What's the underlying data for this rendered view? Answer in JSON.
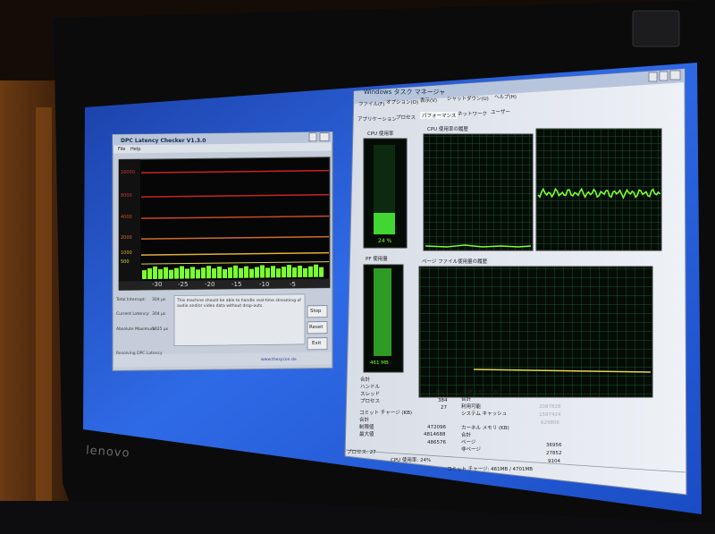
{
  "laptop": {
    "brand": "lenovo"
  },
  "dpc_window": {
    "title": "DPC Latency Checker V1.3.0",
    "menu": [
      "File",
      "Help"
    ],
    "x_ticks": [
      "-30",
      "-25",
      "-20",
      "-15",
      "-10",
      "-5"
    ],
    "y_ticks": [
      "16000",
      "8000",
      "4000",
      "2000",
      "1000",
      "500"
    ],
    "stats_labels": [
      "Total Interrupt:",
      "Current Latency:",
      "Absolute Maximum:"
    ],
    "stats_values": [
      "304 µs",
      "304 µs",
      "1025 µs"
    ],
    "message": "This machine should be able to handle real-time streaming of audio and/or video data without drop-outs.",
    "buttons": [
      "Stop",
      "Reset",
      "Exit"
    ],
    "footer_left": "Resolving DPC Latency",
    "footer_right": "www.thesycon.de"
  },
  "task_manager": {
    "title": "Windows タスク マネージャ",
    "menu": [
      "ファイル(F)",
      "オプション(O)",
      "表示(V)",
      "シャットダウン(U)",
      "ヘルプ(H)"
    ],
    "tabs": [
      "アプリケーション",
      "プロセス",
      "パフォーマンス",
      "ネットワーク",
      "ユーザー"
    ],
    "active_tab": 2,
    "cpu_usage_label": "CPU 使用率",
    "cpu_usage_value": "24 %",
    "cpu_usage_level": 0.24,
    "cpu_history_label": "CPU 使用率の履歴",
    "pf_usage_label": "PF 使用量",
    "pf_usage_value": "461 MB",
    "pf_history_label": "ページ ファイル使用量の履歴",
    "totals": {
      "header": "合計",
      "rows": [
        [
          "ハンドル",
          "7027"
        ],
        [
          "スレッド",
          "384"
        ],
        [
          "プロセス",
          "27"
        ]
      ]
    },
    "physical_memory": {
      "header": "物理メモリ (KB)",
      "rows": [
        [
          "合計",
          "2087828"
        ],
        [
          "利用可能",
          "1597424"
        ],
        [
          "システム キャッシュ",
          "629806"
        ]
      ]
    },
    "commit_charge": {
      "header": "コミット チャージ (KB)",
      "rows": [
        [
          "合計",
          "472096"
        ],
        [
          "制限値",
          "4814688"
        ],
        [
          "最大値",
          "486576"
        ]
      ]
    },
    "kernel_memory": {
      "header": "カーネル メモリ (KB)",
      "rows": [
        [
          "合計",
          "36956"
        ],
        [
          "ページ",
          "27852"
        ],
        [
          "非ページ",
          "9104"
        ]
      ]
    },
    "status_bar": [
      "プロセス: 27",
      "CPU 使用率: 24%",
      "コミット チャージ: 461MB / 4701MB"
    ]
  },
  "colors": {
    "graph_green": "#7cff2e",
    "graph_bg": "#050c06",
    "desktop_blue": "#2c63e0"
  }
}
